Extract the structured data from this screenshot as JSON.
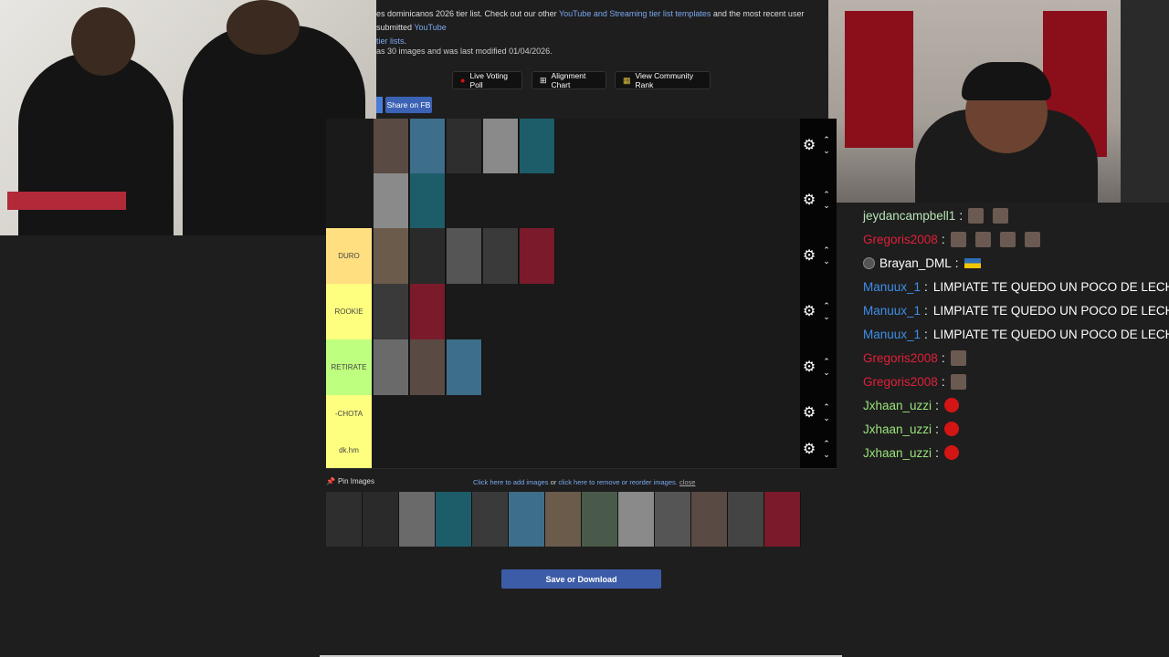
{
  "page": {
    "description_text": "es dominicanos 2026 tier list. Check out our other ",
    "description_link1": "YouTube and Streaming tier list templates",
    "description_mid": " and the most recent user submitted ",
    "description_link2": "YouTube",
    "description_link3": "tier lists",
    "description_end": ".",
    "meta_text": "as 30 images and was last modified 01/04/2026.",
    "buttons": {
      "live_voting": "Live Voting Poll",
      "alignment_chart": "Alignment Chart",
      "community_rank": "View Community Rank",
      "share_fb": "Share on FB"
    }
  },
  "tiers": [
    {
      "label": "",
      "color": "#1a1a1a",
      "thumbs": 5
    },
    {
      "label": "",
      "color": "#1a1a1a",
      "thumbs": 2
    },
    {
      "label": "DURO",
      "color": "#ffdf80",
      "thumbs": 5
    },
    {
      "label": "ROOKIE",
      "color": "#ffff7f",
      "thumbs": 2
    },
    {
      "label": "RETIRATE",
      "color": "#bfff7f",
      "thumbs": 3
    },
    {
      "label": "-CHOTA",
      "color": "#ffff7f",
      "thumbs": 0
    },
    {
      "label": "dk.hm",
      "color": "#ffff7f",
      "thumbs": 0
    }
  ],
  "pool": {
    "pin_label": "Pin Images",
    "add_link": "Click here to add images",
    "or_text": " or ",
    "remove_link": "click here to remove or reorder images.",
    "close_link": "close",
    "thumb_count": 13
  },
  "save_button": "Save or Download",
  "chat": [
    {
      "user": "jeydancampbell1",
      "color": "#b6e3b3",
      "emotes": 2,
      "msg": ""
    },
    {
      "user": "Gregoris2008",
      "color": "#e0203a",
      "emotes": 4,
      "msg": ""
    },
    {
      "user": "Brayan_DML",
      "color": "#ffffff",
      "emotes": 0,
      "msg": "",
      "flag": true,
      "badge": true
    },
    {
      "user": "Manuux_1",
      "color": "#3f8ee8",
      "emotes": 0,
      "msg": "LIMPIATE TE QUEDO UN POCO DE LECHE"
    },
    {
      "user": "Manuux_1",
      "color": "#3f8ee8",
      "emotes": 0,
      "msg": "LIMPIATE TE QUEDO UN POCO DE LECHE"
    },
    {
      "user": "Manuux_1",
      "color": "#3f8ee8",
      "emotes": 0,
      "msg": "LIMPIATE TE QUEDO UN POCO DE LECHE"
    },
    {
      "user": "Gregoris2008",
      "color": "#e0203a",
      "emotes": 1,
      "msg": ""
    },
    {
      "user": "Gregoris2008",
      "color": "#e0203a",
      "emotes": 1,
      "msg": ""
    },
    {
      "user": "Jxhaan_uzzi",
      "color": "#9be37c",
      "emotes": 0,
      "msg": "",
      "red_emote": true
    },
    {
      "user": "Jxhaan_uzzi",
      "color": "#9be37c",
      "emotes": 0,
      "msg": "",
      "red_emote": true
    },
    {
      "user": "Jxhaan_uzzi",
      "color": "#9be37c",
      "emotes": 0,
      "msg": "",
      "red_emote": true
    }
  ]
}
